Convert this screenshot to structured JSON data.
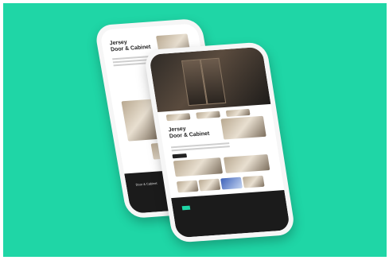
{
  "back_phone": {
    "title_line1": "Jersey",
    "title_line2": "Door & Cabinet"
  },
  "front_phone": {
    "title_line1": "Jersey",
    "title_line2": "Door & Cabinet"
  },
  "colors": {
    "background": "#1fd6a6",
    "phone_body": "#f6f6f6",
    "footer": "#1b1b1b"
  }
}
